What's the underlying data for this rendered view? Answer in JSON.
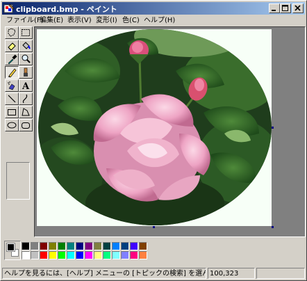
{
  "window": {
    "title": "clipboard.bmp - ペイント",
    "minimize_icon": "minimize-icon",
    "maximize_icon": "maximize-icon",
    "close_icon": "close-icon"
  },
  "menu": [
    {
      "label": "ファイル(F)"
    },
    {
      "label": "編集(E)"
    },
    {
      "label": "表示(V)"
    },
    {
      "label": "変形(I)"
    },
    {
      "label": "色(C)"
    },
    {
      "label": "ヘルプ(H)"
    }
  ],
  "tools": [
    {
      "name": "free-form-select-icon"
    },
    {
      "name": "rect-select-icon"
    },
    {
      "name": "eraser-icon"
    },
    {
      "name": "fill-bucket-icon"
    },
    {
      "name": "color-picker-icon"
    },
    {
      "name": "magnifier-icon"
    },
    {
      "name": "pencil-icon",
      "active": true
    },
    {
      "name": "brush-icon"
    },
    {
      "name": "airbrush-icon"
    },
    {
      "name": "text-icon",
      "glyph": "A"
    },
    {
      "name": "line-icon"
    },
    {
      "name": "curve-icon"
    },
    {
      "name": "rectangle-icon"
    },
    {
      "name": "polygon-icon"
    },
    {
      "name": "ellipse-icon"
    },
    {
      "name": "rounded-rect-icon"
    }
  ],
  "palette": {
    "foreground": "#000000",
    "background": "#ffffff",
    "row1": [
      "#000000",
      "#808080",
      "#800000",
      "#808000",
      "#008000",
      "#008080",
      "#000080",
      "#800080",
      "#808040",
      "#004040",
      "#0080ff",
      "#004080",
      "#4000ff",
      "#804000"
    ],
    "row2": [
      "#ffffff",
      "#c0c0c0",
      "#ff0000",
      "#ffff00",
      "#00ff00",
      "#00ffff",
      "#0000ff",
      "#ff00ff",
      "#ffff80",
      "#00ff80",
      "#80ffff",
      "#8080ff",
      "#ff0080",
      "#ff8040"
    ]
  },
  "status": {
    "help_text": "ヘルプを見るには、[ヘルプ] メニューの [トピックの検索] を選んで",
    "coordinates": "100,323",
    "size": ""
  }
}
